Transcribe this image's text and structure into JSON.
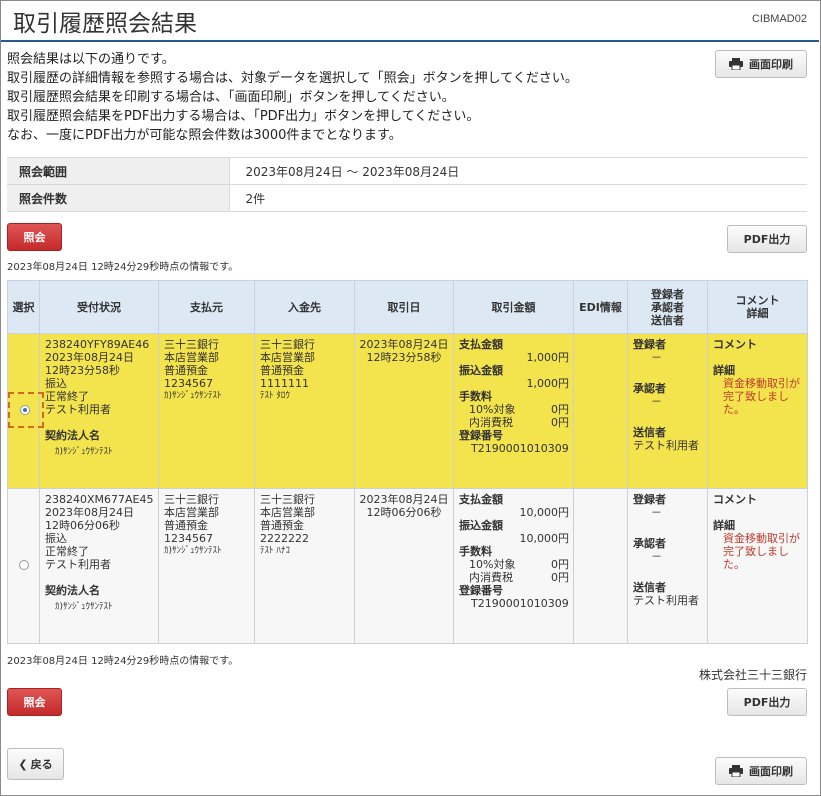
{
  "header": {
    "title": "取引履歴照会結果",
    "screen_id": "CIBMAD02"
  },
  "intro": [
    "照会結果は以下の通りです。",
    "取引履歴の詳細情報を参照する場合は、対象データを選択して「照会」ボタンを押してください。",
    "取引履歴照会結果を印刷する場合は、「画面印刷」ボタンを押してください。",
    "取引履歴照会結果をPDF出力する場合は、「PDF出力」ボタンを押してください。",
    "なお、一度にPDF出力が可能な照会件数は3000件までとなります。"
  ],
  "buttons": {
    "print": "画面印刷",
    "inquiry": "照会",
    "pdf": "PDF出力",
    "back": "戻る"
  },
  "summary": {
    "range_label": "照会範囲",
    "range_value": "2023年08月24日 ～ 2023年08月24日",
    "count_label": "照会件数",
    "count_value": "2件"
  },
  "info_time": "2023年08月24日 12時24分29秒時点の情報です。",
  "columns": {
    "select": "選択",
    "status": "受付状況",
    "payer": "支払元",
    "payee": "入金先",
    "date": "取引日",
    "amount": "取引金額",
    "edi": "EDI情報",
    "approvers": [
      "登録者",
      "承認者",
      "送信者"
    ],
    "comment": [
      "コメント",
      "詳細"
    ]
  },
  "labels": {
    "payment_amount": "支払金額",
    "transfer_amount": "振込金額",
    "fee": "手数料",
    "fee_10": "10%対象",
    "fee_tax": "内消費税",
    "reg_no": "登録番号",
    "corp_name": "契約法人名",
    "registrant": "登録者",
    "approver": "承認者",
    "sender": "送信者",
    "comment": "コメント",
    "detail": "詳細"
  },
  "rows": [
    {
      "selected": true,
      "status": [
        "238240YFY89AE46",
        "2023年08月24日",
        "12時23分58秒",
        "振込",
        "正常終了",
        "テスト利用者"
      ],
      "corp_name": "ｶ)ｻﾝｼﾞｭｳｻﾝﾃｽﾄ",
      "payer": [
        "三十三銀行",
        "本店営業部",
        "普通預金",
        "1234567"
      ],
      "payer_kana": "ｶ)ｻﾝｼﾞｭｳｻﾝﾃｽﾄ",
      "payee": [
        "三十三銀行",
        "本店営業部",
        "普通預金",
        "1111111"
      ],
      "payee_kana": "ﾃｽﾄ ﾀﾛｳ",
      "date": [
        "2023年08月24日",
        "12時23分58秒"
      ],
      "payment_amount": "1,000円",
      "transfer_amount": "1,000円",
      "fee_10": "0円",
      "fee_tax": "0円",
      "reg_no": "T2190001010309",
      "registrant": "－",
      "approver": "－",
      "sender": "テスト利用者",
      "detail": [
        "資金移動取引が",
        "完了致しまし",
        "た。"
      ]
    },
    {
      "selected": false,
      "status": [
        "238240XM677AE45",
        "2023年08月24日",
        "12時06分06秒",
        "振込",
        "正常終了",
        "テスト利用者"
      ],
      "corp_name": "ｶ)ｻﾝｼﾞｭｳｻﾝﾃｽﾄ",
      "payer": [
        "三十三銀行",
        "本店営業部",
        "普通預金",
        "1234567"
      ],
      "payer_kana": "ｶ)ｻﾝｼﾞｭｳｻﾝﾃｽﾄ",
      "payee": [
        "三十三銀行",
        "本店営業部",
        "普通預金",
        "2222222"
      ],
      "payee_kana": "ﾃｽﾄ ﾊﾅｺ",
      "date": [
        "2023年08月24日",
        "12時06分06秒"
      ],
      "payment_amount": "10,000円",
      "transfer_amount": "10,000円",
      "fee_10": "0円",
      "fee_tax": "0円",
      "reg_no": "T2190001010309",
      "registrant": "－",
      "approver": "－",
      "sender": "テスト利用者",
      "detail": [
        "資金移動取引が",
        "完了致しまし",
        "た。"
      ]
    }
  ],
  "footer": {
    "bank": "株式会社三十三銀行"
  }
}
